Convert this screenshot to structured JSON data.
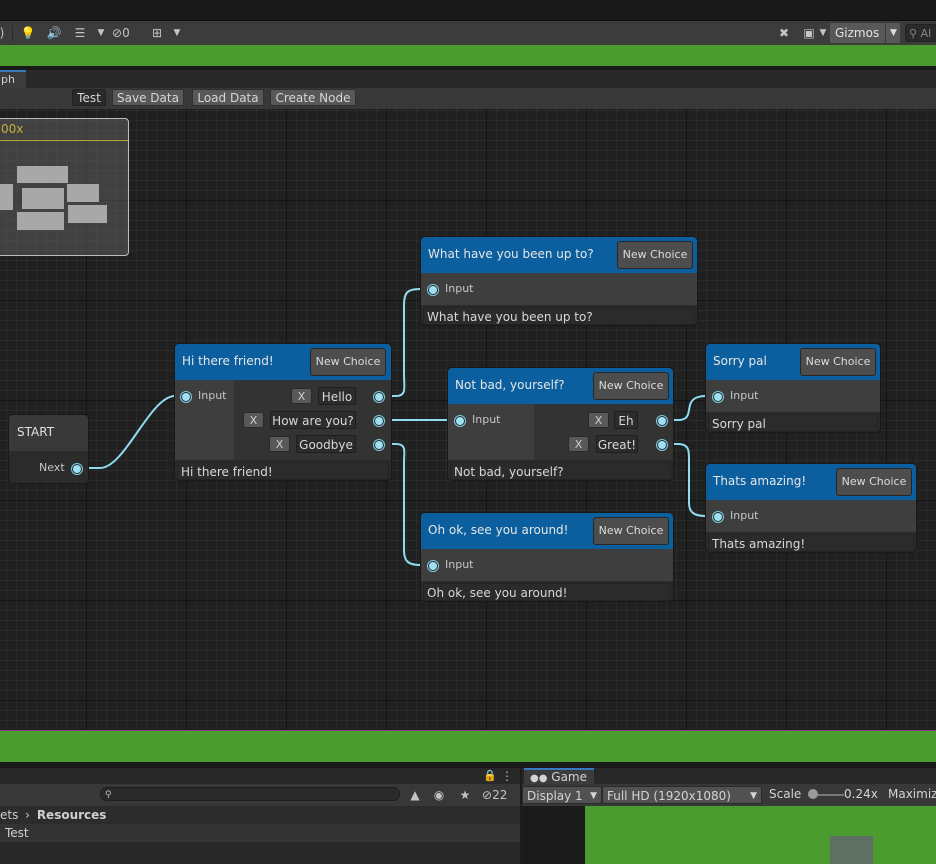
{
  "scene_toolbar": {
    "hidden_count": "0",
    "gizmos_label": "Gizmos",
    "search_placeholder": "Al"
  },
  "window": {
    "tab_label": "ph"
  },
  "graph_toolbar": {
    "test_label": "Test",
    "save_label": "Save Data",
    "load_label": "Load Data",
    "create_label": "Create Node"
  },
  "minimap": {
    "zoom_label": "00x"
  },
  "start_node": {
    "title": "START",
    "output_label": "Next"
  },
  "nodes": {
    "hi": {
      "title": "Hi there friend!",
      "new_choice": "New Choice",
      "input_label": "Input",
      "remove_label": "X",
      "choices": [
        "Hello",
        "How are you?",
        "Goodbye"
      ],
      "text": "Hi there friend!"
    },
    "what": {
      "title": "What have you been up to?",
      "new_choice": "New Choice",
      "input_label": "Input",
      "text": "What have you been up to?"
    },
    "notbad": {
      "title": "Not bad, yourself?",
      "new_choice": "New Choice",
      "input_label": "Input",
      "remove_label": "X",
      "choices": [
        "Eh",
        "Great!"
      ],
      "text": "Not bad, yourself?"
    },
    "ohok": {
      "title": "Oh ok, see you around!",
      "new_choice": "New Choice",
      "input_label": "Input",
      "text": "Oh ok, see you around!"
    },
    "sorry": {
      "title": "Sorry pal",
      "new_choice": "New Choice",
      "input_label": "Input",
      "text": "Sorry pal"
    },
    "amazing": {
      "title": "Thats amazing!",
      "new_choice": "New Choice",
      "input_label": "Input",
      "text": "Thats amazing!"
    }
  },
  "colors": {
    "node_header": "#0b5f9e",
    "wire": "#8fdcf0",
    "scene_green": "#4c9b2f"
  },
  "project_panel": {
    "hidden_count": "22",
    "breadcrumb_parent": "ets",
    "breadcrumb_current": "Resources",
    "item": "Test"
  },
  "game_panel": {
    "tab_label": "Game",
    "display": "Display 1",
    "resolution": "Full HD (1920x1080)",
    "scale_label": "Scale",
    "scale_value": "0.24x",
    "maximize": "Maximiz"
  }
}
